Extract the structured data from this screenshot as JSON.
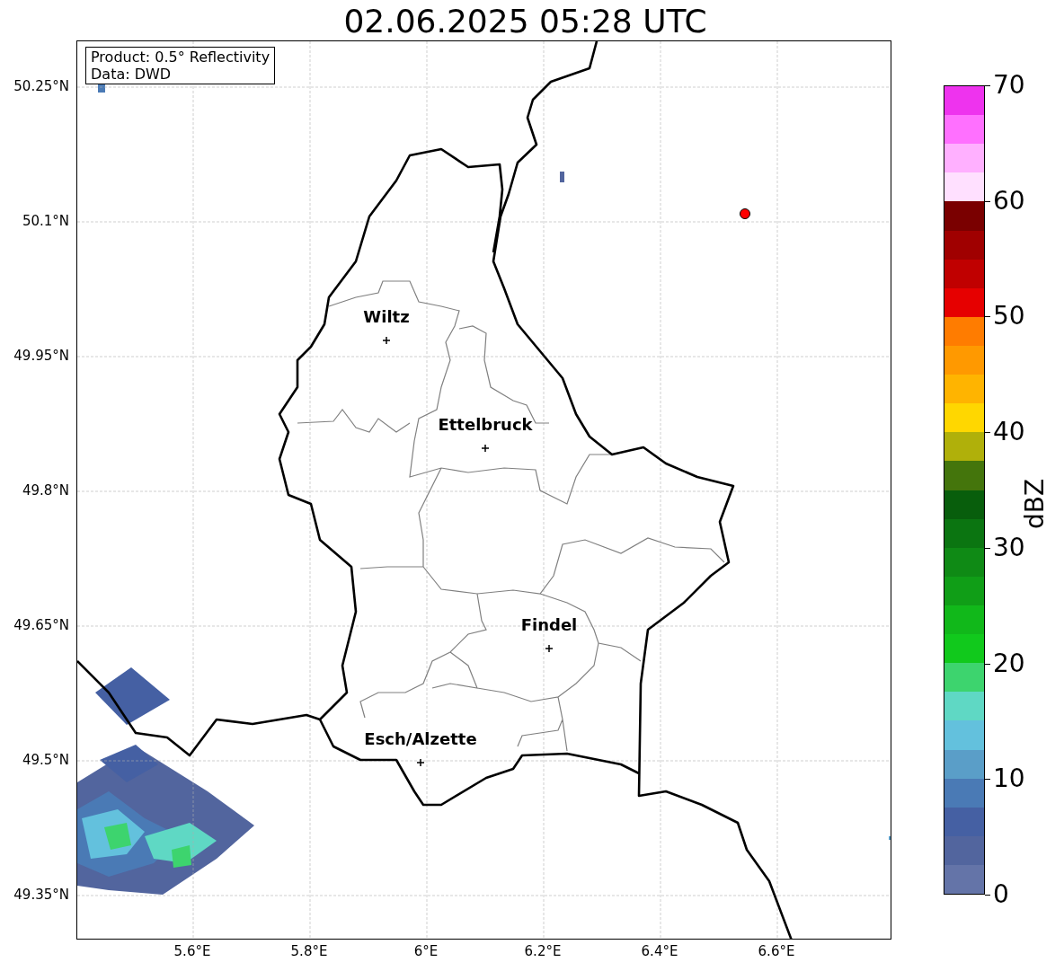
{
  "title": "02.06.2025 05:28 UTC",
  "info_box": [
    "Product: 0.5° Reflectivity",
    "Data: DWD"
  ],
  "map": {
    "lat_labels": [
      "50.25°N",
      "50.1°N",
      "49.95°N",
      "49.8°N",
      "49.65°N",
      "49.5°N",
      "49.35°N"
    ],
    "lon_labels": [
      "5.6°E",
      "5.8°E",
      "6°E",
      "6.2°E",
      "6.4°E",
      "6.6°E"
    ],
    "cities": [
      {
        "name": "Wiltz"
      },
      {
        "name": "Ettelbruck"
      },
      {
        "name": "Findel"
      },
      {
        "name": "Esch/Alzette"
      }
    ]
  },
  "colorbar": {
    "label": "dBZ",
    "ticks": [
      "70",
      "60",
      "50",
      "40",
      "30",
      "20",
      "10",
      "0"
    ],
    "bands": [
      {
        "color": "#ee33ee"
      },
      {
        "color": "#ff70ff"
      },
      {
        "color": "#ffb0ff"
      },
      {
        "color": "#ffe0ff"
      },
      {
        "color": "#7a0000"
      },
      {
        "color": "#a00000"
      },
      {
        "color": "#c00000"
      },
      {
        "color": "#e60000"
      },
      {
        "color": "#ff7c00"
      },
      {
        "color": "#ff9900"
      },
      {
        "color": "#ffb400"
      },
      {
        "color": "#ffd700"
      },
      {
        "color": "#b0b00a"
      },
      {
        "color": "#44750c"
      },
      {
        "color": "#085e0c"
      },
      {
        "color": "#0b7511"
      },
      {
        "color": "#0f8a15"
      },
      {
        "color": "#109e17"
      },
      {
        "color": "#11b81a"
      },
      {
        "color": "#11c91c"
      },
      {
        "color": "#3dd46e"
      },
      {
        "color": "#5fd8c4"
      },
      {
        "color": "#63c1dd"
      },
      {
        "color": "#5a9ec8"
      },
      {
        "color": "#4a7ab5"
      },
      {
        "color": "#4560a3"
      },
      {
        "color": "#52659e"
      },
      {
        "color": "#6474a8"
      }
    ]
  }
}
